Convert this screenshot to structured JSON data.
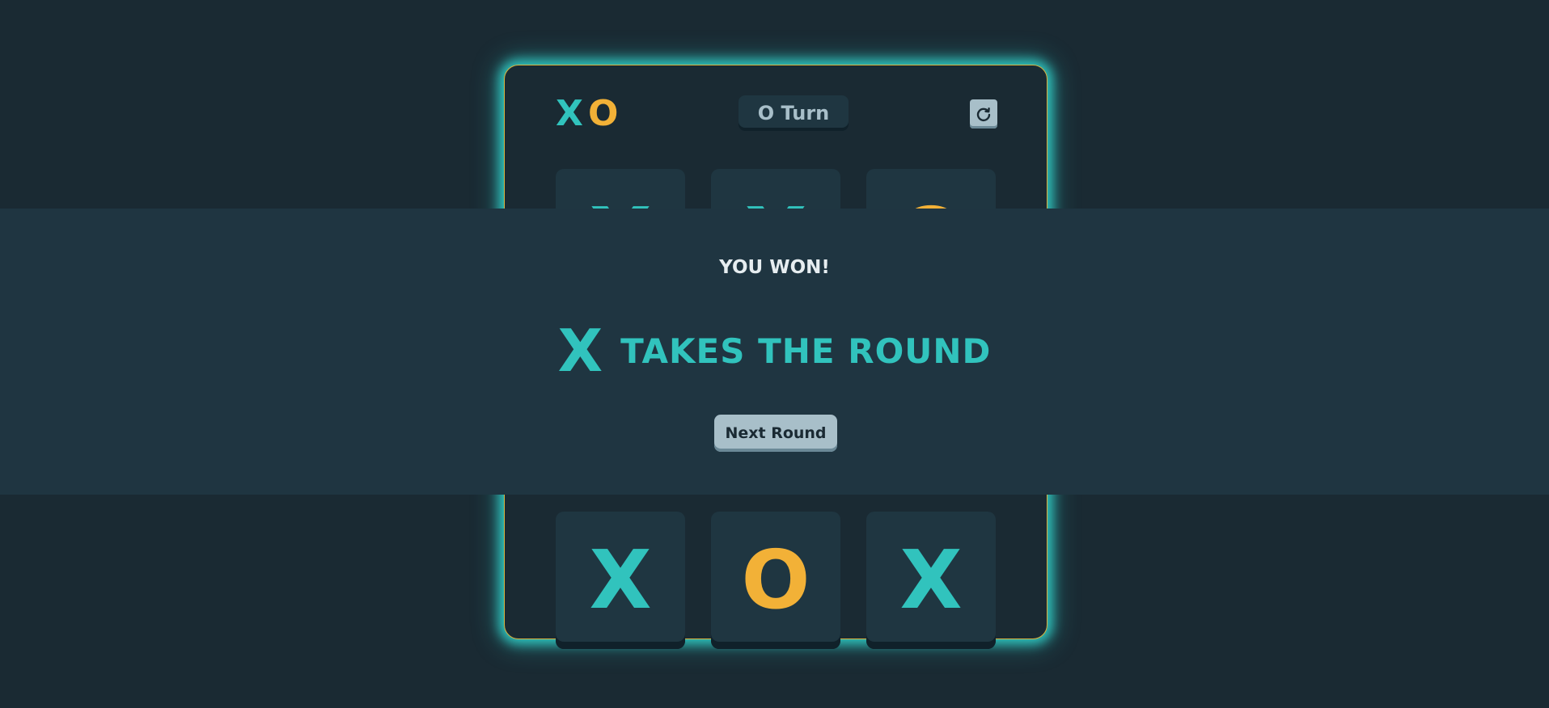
{
  "logo": {
    "x": "X",
    "o": "O"
  },
  "turn": {
    "label": "O Turn"
  },
  "restart": {
    "icon": "restart-icon"
  },
  "board": {
    "cells": [
      "X",
      "X",
      "O",
      "",
      "",
      "",
      "X",
      "O",
      "X"
    ]
  },
  "result": {
    "heading": "YOU WON!",
    "winner_mark": "X",
    "message": "TAKES THE ROUND",
    "next_button": "Next Round"
  },
  "colors": {
    "background": "#1a2a33",
    "panel": "#1f3641",
    "x": "#31c3bd",
    "o": "#f2b137",
    "silver": "#a8bfc9"
  }
}
